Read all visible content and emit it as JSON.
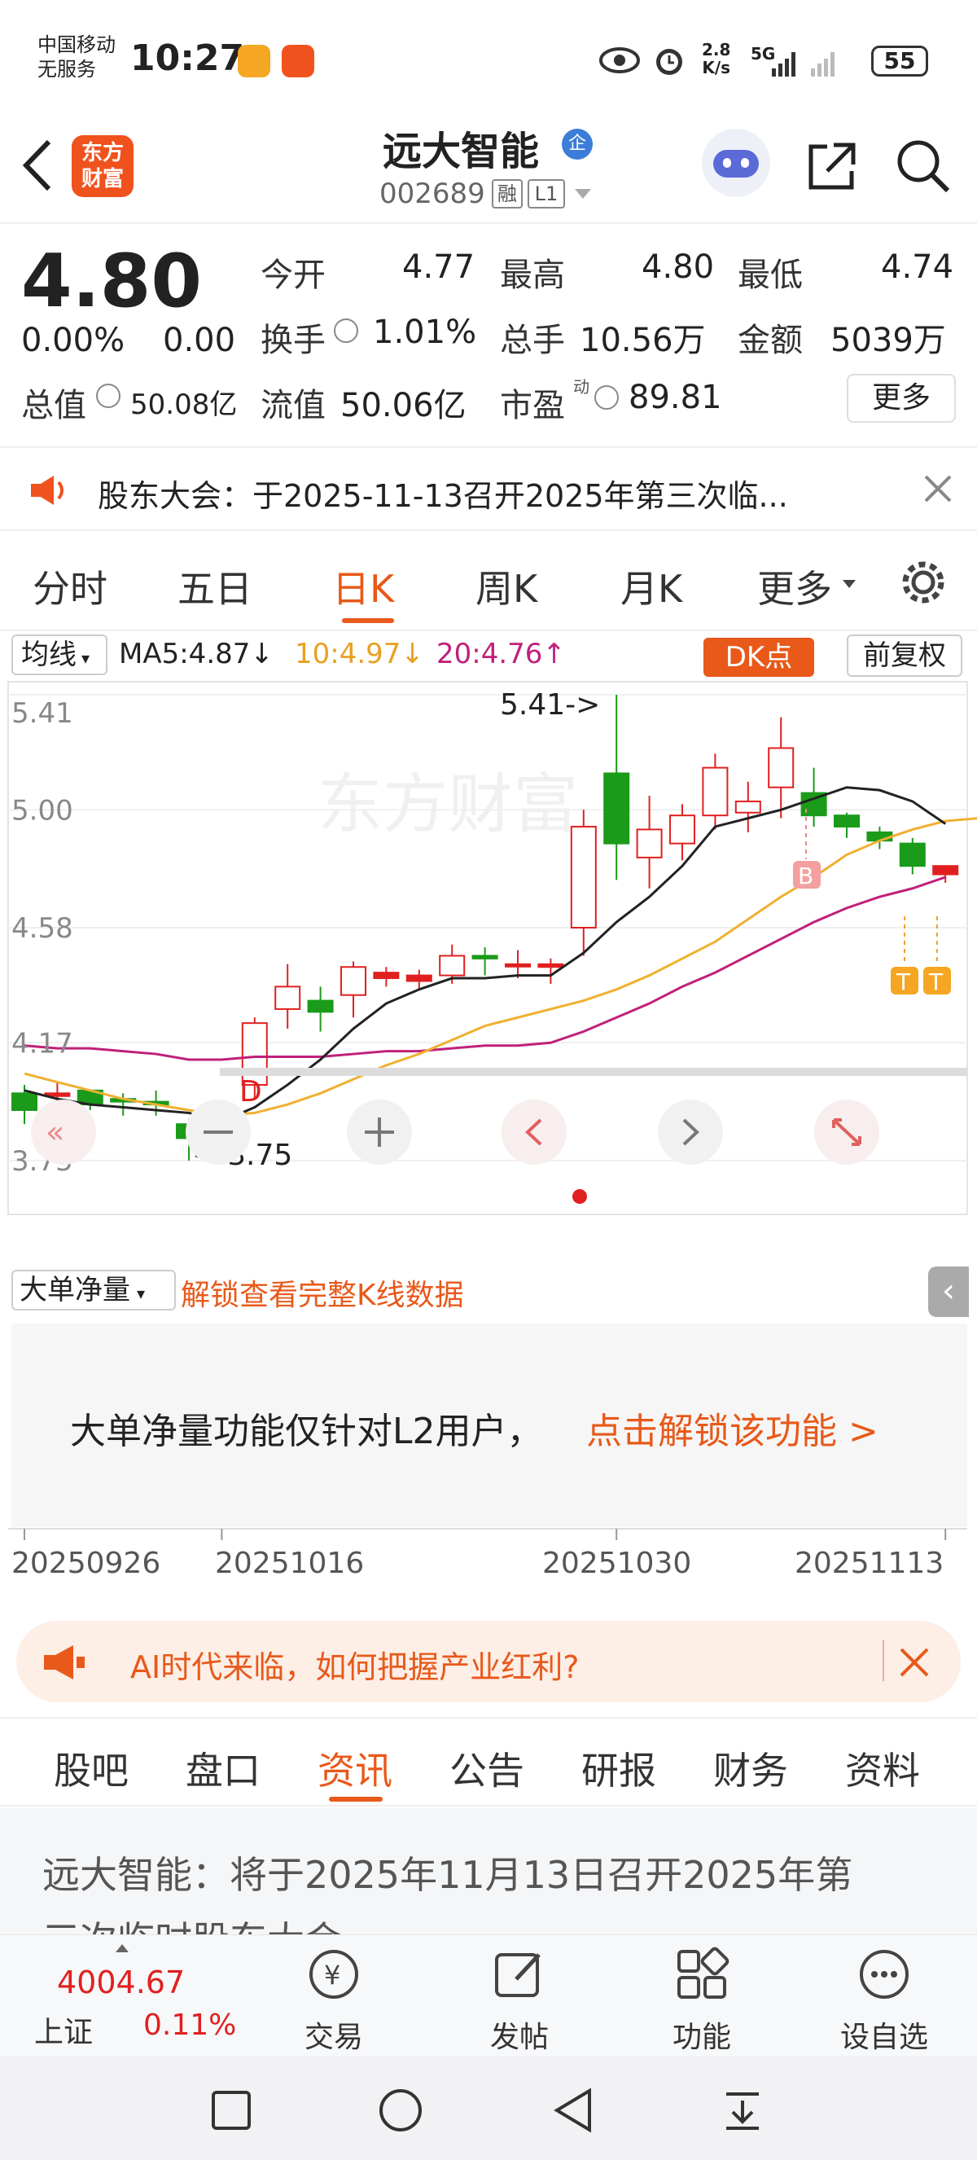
{
  "status_bar": {
    "carrier_line1": "中国移动",
    "carrier_line2": "无服务",
    "time": "10:27",
    "net_speed_top": "2.8",
    "net_speed_bottom": "K/s",
    "signal_label": "5G",
    "battery": "55"
  },
  "header": {
    "title": "远大智能",
    "enterprise_badge": "企",
    "code": "002689",
    "tag1": "融",
    "tag2": "L1",
    "logo_line1": "东方",
    "logo_line2": "财富"
  },
  "quote": {
    "price": "4.80",
    "change_pct": "0.00%",
    "change_amt": "0.00",
    "open_label": "今开",
    "open": "4.77",
    "high_label": "最高",
    "high": "4.80",
    "low_label": "最低",
    "low": "4.74",
    "turnover_label": "换手",
    "turnover": "1.01%",
    "volume_label": "总手",
    "volume": "10.56万",
    "amount_label": "金额",
    "amount": "5039万",
    "mktcap_label": "总值",
    "mktcap": "50.08亿",
    "float_label": "流值",
    "float_cap": "50.06亿",
    "pe_label": "市盈",
    "pe_sup": "动",
    "pe": "89.81",
    "more_button": "更多"
  },
  "notice": {
    "text": "股东大会：于2025-11-13召开2025年第三次临..."
  },
  "chart_tabs": {
    "items": [
      "分时",
      "五日",
      "日K",
      "周K",
      "月K",
      "更多"
    ],
    "active": "日K"
  },
  "indicator_bar": {
    "ma_label": "均线",
    "ma5": "MA5:4.87↓",
    "ma10": "10:4.97↓",
    "ma20": "20:4.76↑",
    "dk_button": "DK点",
    "adjust_button": "前复权"
  },
  "chart_labels": {
    "y_ticks": [
      "5.41",
      "5.00",
      "4.58",
      "4.17",
      "3.75"
    ],
    "max_annotation": "5.41->",
    "min_annotation": "<-3.75",
    "marker_b": "B",
    "marker_d": "D",
    "marker_t1": "T",
    "marker_t2": "T",
    "watermark": "东方财富"
  },
  "chart_data": {
    "type": "candlestick",
    "ylim": [
      3.75,
      5.41
    ],
    "candles": [
      {
        "o": 3.99,
        "c": 3.93,
        "h": 4.02,
        "l": 3.88
      },
      {
        "o": 3.98,
        "c": 3.99,
        "h": 4.03,
        "l": 3.88
      },
      {
        "o": 4.0,
        "c": 3.95,
        "h": 4.0,
        "l": 3.93
      },
      {
        "o": 3.97,
        "c": 3.96,
        "h": 3.99,
        "l": 3.91
      },
      {
        "o": 3.96,
        "c": 3.95,
        "h": 4.0,
        "l": 3.91
      },
      {
        "o": 3.88,
        "c": 3.83,
        "h": 3.9,
        "l": 3.75
      },
      {
        "o": 3.84,
        "c": 3.91,
        "h": 3.96,
        "l": 3.84
      },
      {
        "o": 4.02,
        "c": 4.24,
        "h": 4.26,
        "l": 3.97
      },
      {
        "o": 4.29,
        "c": 4.37,
        "h": 4.45,
        "l": 4.22
      },
      {
        "o": 4.32,
        "c": 4.28,
        "h": 4.37,
        "l": 4.21
      },
      {
        "o": 4.34,
        "c": 4.44,
        "h": 4.46,
        "l": 4.26
      },
      {
        "o": 4.4,
        "c": 4.42,
        "h": 4.44,
        "l": 4.37
      },
      {
        "o": 4.39,
        "c": 4.41,
        "h": 4.43,
        "l": 4.36
      },
      {
        "o": 4.41,
        "c": 4.48,
        "h": 4.52,
        "l": 4.38
      },
      {
        "o": 4.48,
        "c": 4.47,
        "h": 4.51,
        "l": 4.41
      },
      {
        "o": 4.45,
        "c": 4.45,
        "h": 4.5,
        "l": 4.4
      },
      {
        "o": 4.44,
        "c": 4.45,
        "h": 4.47,
        "l": 4.38
      },
      {
        "o": 4.58,
        "c": 4.94,
        "h": 5.0,
        "l": 4.48
      },
      {
        "o": 5.13,
        "c": 4.88,
        "h": 5.41,
        "l": 4.75
      },
      {
        "o": 4.83,
        "c": 4.93,
        "h": 5.05,
        "l": 4.72
      },
      {
        "o": 4.88,
        "c": 4.98,
        "h": 5.02,
        "l": 4.82
      },
      {
        "o": 4.98,
        "c": 5.15,
        "h": 5.2,
        "l": 4.93
      },
      {
        "o": 4.99,
        "c": 5.03,
        "h": 5.1,
        "l": 4.92
      },
      {
        "o": 5.08,
        "c": 5.22,
        "h": 5.33,
        "l": 4.97
      },
      {
        "o": 5.06,
        "c": 4.98,
        "h": 5.15,
        "l": 4.94
      },
      {
        "o": 4.98,
        "c": 4.94,
        "h": 4.99,
        "l": 4.9
      },
      {
        "o": 4.92,
        "c": 4.89,
        "h": 4.94,
        "l": 4.86
      },
      {
        "o": 4.88,
        "c": 4.8,
        "h": 4.9,
        "l": 4.77
      },
      {
        "o": 4.77,
        "c": 4.8,
        "h": 4.8,
        "l": 4.74
      }
    ],
    "ma5": [
      4.0,
      3.97,
      3.95,
      3.94,
      3.93,
      3.92,
      3.89,
      3.94,
      4.02,
      4.11,
      4.22,
      4.31,
      4.36,
      4.4,
      4.4,
      4.41,
      4.41,
      4.49,
      4.6,
      4.69,
      4.8,
      4.94,
      4.97,
      5.0,
      5.04,
      5.08,
      5.07,
      5.03,
      4.95
    ],
    "ma10": [
      4.06,
      4.03,
      4.0,
      3.97,
      3.95,
      3.93,
      3.91,
      3.92,
      3.95,
      3.99,
      4.04,
      4.09,
      4.13,
      4.18,
      4.23,
      4.26,
      4.29,
      4.32,
      4.36,
      4.41,
      4.47,
      4.53,
      4.61,
      4.69,
      4.76,
      4.84,
      4.89,
      4.93,
      4.96,
      4.97
    ],
    "ma20": [
      4.16,
      4.15,
      4.15,
      4.14,
      4.13,
      4.11,
      4.11,
      4.12,
      4.12,
      4.12,
      4.13,
      4.14,
      4.14,
      4.15,
      4.16,
      4.16,
      4.17,
      4.21,
      4.26,
      4.31,
      4.37,
      4.42,
      4.48,
      4.54,
      4.6,
      4.65,
      4.69,
      4.72,
      4.76
    ],
    "x_labels": [
      "20250926",
      "20251016",
      "20251030",
      "20251113"
    ],
    "ma_colors": {
      "ma5": "#222222",
      "ma10": "#f0b030",
      "ma20": "#c0207a"
    },
    "up_color": "#e02020",
    "down_color": "#1a9b1a"
  },
  "l2_panel": {
    "selector": "大单净量",
    "unlock_text": "解锁查看完整K线数据",
    "message": "大单净量功能仅针对L2用户，",
    "link": "点击解锁该功能 >"
  },
  "ad_banner": {
    "text": "AI时代来临，如何把握产业红利?"
  },
  "info_tabs": {
    "items": [
      "股吧",
      "盘口",
      "资讯",
      "公告",
      "研报",
      "财务",
      "资料"
    ],
    "active": "资讯"
  },
  "news": {
    "line1": "远大智能：将于2025年11月13日召开2025年第",
    "line2": "三次临时股东大会"
  },
  "bottom_bar": {
    "index_value": "4004.67",
    "index_name": "上证",
    "index_change": "0.11%",
    "items": [
      "交易",
      "发帖",
      "功能",
      "设自选"
    ]
  },
  "colors": {
    "accent": "#e8591a",
    "up": "#e02020",
    "down": "#1a9b1a"
  }
}
